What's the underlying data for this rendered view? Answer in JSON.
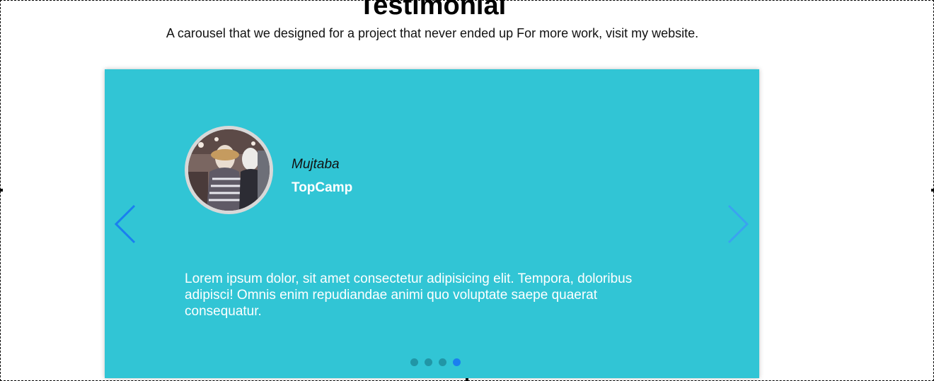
{
  "header": {
    "title": "Testimonial",
    "subtitle": "A carousel that we designed for a project that never ended up For more work, visit my website."
  },
  "carousel": {
    "background_color": "#31c5d5",
    "slide": {
      "avatar_icon": "avatar-photo-icon",
      "name": "Mujtaba",
      "company": "TopCamp",
      "quote": "Lorem ipsum dolor, sit amet consectetur adipisicing elit. Tempora, doloribus adipisci! Omnis enim repudiandae animi quo voluptate saepe quaerat consequatur."
    },
    "prev_icon": "chevron-left-icon",
    "next_icon": "chevron-right-icon",
    "indicators": {
      "count": 4,
      "active_index": 4,
      "active_color": "#1a7ff0",
      "inactive_color": "#2196a6"
    }
  }
}
